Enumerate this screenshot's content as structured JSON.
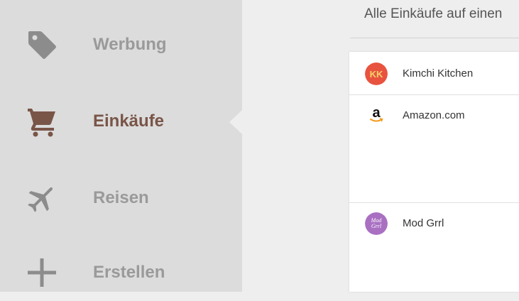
{
  "sidebar": {
    "items": [
      {
        "label": "Werbung",
        "icon": "tag-icon",
        "active": false
      },
      {
        "label": "Einkäufe",
        "icon": "shopping-cart-icon",
        "active": true
      },
      {
        "label": "Reisen",
        "icon": "airplane-icon",
        "active": false
      },
      {
        "label": "Erstellen",
        "icon": "plus-icon",
        "active": false
      }
    ]
  },
  "main": {
    "title": "Alle Einkäufe auf einen",
    "merchants": [
      {
        "name": "Kimchi Kitchen",
        "logo": "kimchi-kitchen-logo",
        "logo_text": "KK"
      },
      {
        "name": "Amazon.com",
        "logo": "amazon-logo",
        "logo_text": "a"
      },
      {
        "name": "Mod Grrl",
        "logo": "mod-grrl-logo",
        "logo_text": "Mod Grrl"
      }
    ]
  },
  "colors": {
    "sidebar_bg": "#dcdcdc",
    "content_bg": "#eeeeee",
    "inactive_text": "#9a9a9a",
    "active_text": "#795548",
    "kimchi_red": "#e8533f",
    "mod_grrl_purple": "#a970c2",
    "amazon_orange": "#f39a1d"
  }
}
